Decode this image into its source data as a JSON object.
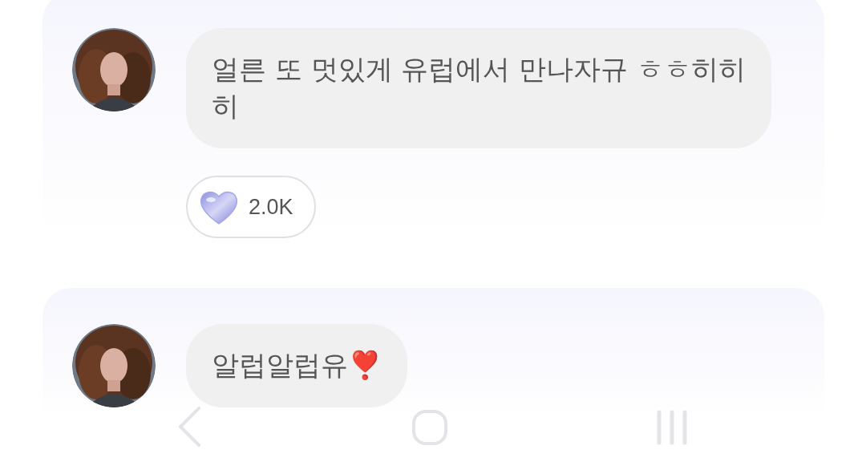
{
  "messages": [
    {
      "text": "얼른 또 멋있게 유럽에서 만나자규 ㅎㅎ히히\n히",
      "reaction": {
        "count": "2.0K"
      }
    },
    {
      "text": "알럽알럽유❣️"
    }
  ]
}
